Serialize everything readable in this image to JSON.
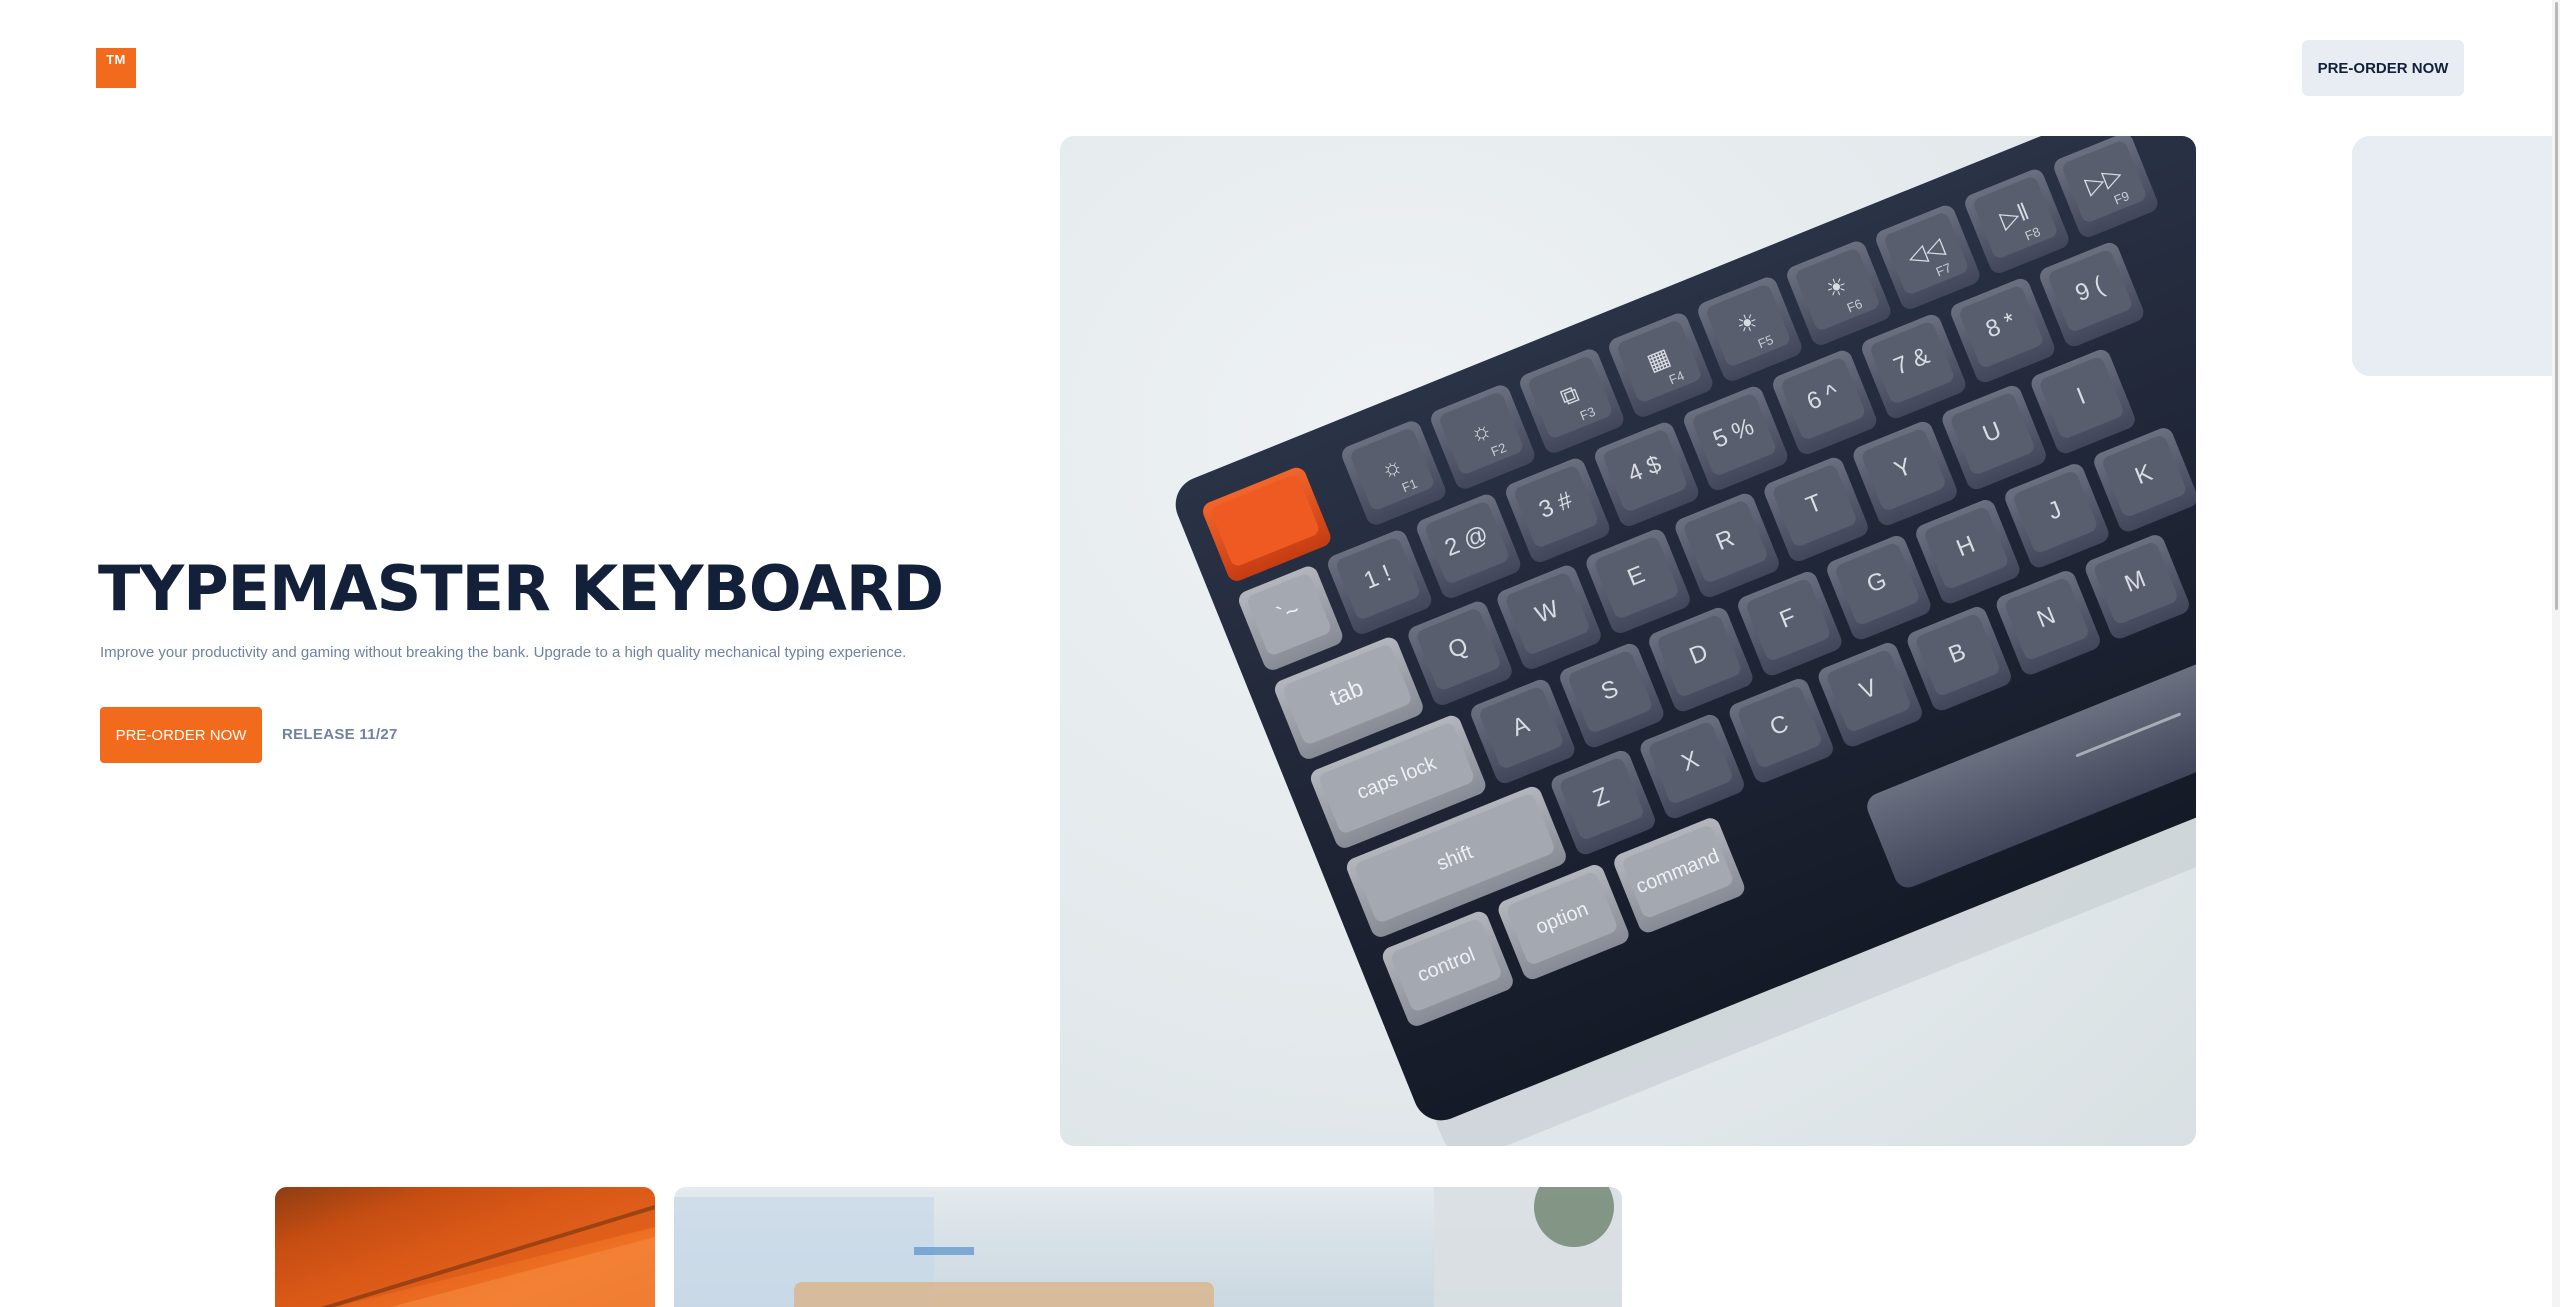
{
  "header": {
    "logo_text": "TM",
    "cta_label": "PRE-ORDER NOW"
  },
  "hero": {
    "title": "TYPEMASTER KEYBOARD",
    "subtitle": "Improve your productivity and gaming without breaking the bank. Upgrade to a high quality mechanical typing experience.",
    "cta_label": "PRE-ORDER NOW",
    "release_text": "RELEASE 11/27"
  },
  "keyboard": {
    "rows": [
      [
        "☼",
        "☼",
        "⧉",
        "▦",
        "☀",
        "☀",
        "◁◁",
        "▷ǁ",
        "▷▷"
      ],
      [
        "`~",
        "1 !",
        "2 @",
        "3 #",
        "4 $",
        "5 %",
        "6 ^",
        "7 &",
        "8 *",
        "9 ("
      ],
      [
        "tab",
        "Q",
        "W",
        "E",
        "R",
        "T",
        "Y",
        "U",
        "I"
      ],
      [
        "caps lock",
        "A",
        "S",
        "D",
        "F",
        "G",
        "H",
        "J",
        "K"
      ],
      [
        "shift",
        "Z",
        "X",
        "C",
        "V",
        "B",
        "N",
        "M"
      ],
      [
        "control",
        "option",
        "command"
      ]
    ],
    "fn_sublabels": [
      "F1",
      "F2",
      "F3",
      "F4",
      "F5",
      "F6",
      "F7",
      "F8",
      "F9"
    ],
    "colors": {
      "case": "#1d2436",
      "key": "#4f5565",
      "mod_key": "#9a9ea6",
      "accent_key": "#e8501d"
    }
  },
  "colors": {
    "accent": "#f26a1b",
    "navy": "#12203a",
    "muted": "#6f82a3",
    "light_panel": "#e7edf2"
  }
}
